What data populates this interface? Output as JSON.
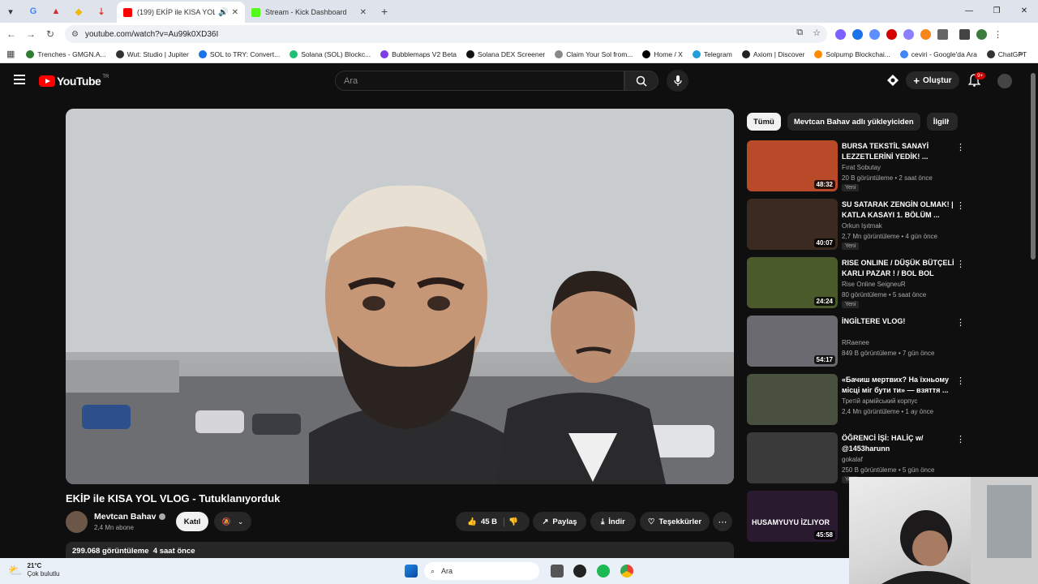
{
  "browser": {
    "tabs": [
      {
        "title": "(199) EKİP ile KISA YOL VLOG",
        "active": true,
        "favicon_color": "#ff0000"
      },
      {
        "title": "Stream - Kick Dashboard",
        "active": false,
        "favicon_color": "#53fc18"
      }
    ],
    "url": "youtube.com/watch?v=Au99k0XD36I",
    "bookmarks": [
      {
        "label": "Trenches - GMGN.A...",
        "color": "#2e7d32"
      },
      {
        "label": "Wut: Studio | Jupiter",
        "color": "#333333"
      },
      {
        "label": "SOL to TRY: Convert...",
        "color": "#1a73e8"
      },
      {
        "label": "Solana (SOL) Blockc...",
        "color": "#21bf73"
      },
      {
        "label": "Bubblemaps V2 Beta",
        "color": "#7b3fe4"
      },
      {
        "label": "Solana DEX Screener",
        "color": "#111111"
      },
      {
        "label": "Claim Your Sol from...",
        "color": "#888888"
      },
      {
        "label": "Home / X",
        "color": "#000000"
      },
      {
        "label": "Telegram",
        "color": "#229ed9"
      },
      {
        "label": "Axiom | Discover",
        "color": "#222222"
      },
      {
        "label": "Solpump Blockchai...",
        "color": "#ff8c00"
      },
      {
        "label": "ceviri - Google'da Ara",
        "color": "#4285f4"
      },
      {
        "label": "ChatGPT",
        "color": "#333333"
      }
    ]
  },
  "youtube": {
    "logo_text": "YouTube",
    "country_code": "TR",
    "search_placeholder": "Ara",
    "create_label": "Oluştur",
    "notification_count": "9+",
    "video": {
      "title": "EKİP ile KISA YOL VLOG - Tutuklanıyorduk",
      "channel": "Mevtcan Bahav",
      "subscribers": "2,4 Mn abone",
      "join_label": "Katıl",
      "likes": "45 B",
      "share_label": "Paylaş",
      "download_label": "İndir",
      "thanks_label": "Teşekkürler",
      "views": "299.068 görüntüleme",
      "age": "4 saat önce"
    },
    "chips": [
      "Tümü",
      "Mevtcan Bahav adlı yükleyiciden",
      "İlgili"
    ],
    "recommendations": [
      {
        "title": "BURSA TEKSTİL SANAYİ LEZZETLERİNİ YEDİK! ...",
        "channel": "Fırat Sobutay",
        "meta": "20 B görüntüleme • 2 saat önce",
        "badge": "Yeni",
        "duration": "48:32",
        "thumb": "#b84a2a"
      },
      {
        "title": "SU SATARAK ZENGİN OLMAK! | KATLA KASAYI 1. BÖLÜM ...",
        "channel": "Orkun Işıtmak",
        "meta": "2,7 Mn görüntüleme • 4 gün önce",
        "badge": "Yeni",
        "duration": "40:07",
        "thumb": "#3a2a20"
      },
      {
        "title": "RISE ONLINE / DÜŞÜK BÜTÇELİ KARLI PAZAR ! / BOL BOL FAR...",
        "channel": "Rise Online SeigneuR",
        "meta": "80 görüntüleme • 5 saat önce",
        "badge": "Yeni",
        "duration": "24:24",
        "thumb": "#4a5a2a"
      },
      {
        "title": "İNGİLTERE VLOG!",
        "channel": "RRaenee",
        "meta": "849 B görüntüleme • 7 gün önce",
        "badge": "",
        "duration": "54:17",
        "thumb": "#6a6a70"
      },
      {
        "title": "«Бачиш мертвих? На їхньому місці міг бути ти» — взяття ...",
        "channel": "Третій армійський корпус",
        "meta": "2,4 Mn görüntüleme • 1 ay önce",
        "badge": "",
        "duration": "",
        "thumb": "#4a5040"
      },
      {
        "title": "ÖĞRENCİ İŞİ: HALİÇ w/ @1453harunn",
        "channel": "gokalaf",
        "meta": "250 B görüntüleme • 5 gün önce",
        "badge": "Yeni",
        "duration": "",
        "thumb": "#3a3a3a"
      },
      {
        "title": "",
        "channel": "",
        "meta": "",
        "badge": "",
        "duration": "45:58",
        "thumb": "#2a1a30",
        "overlay": "HUSAMYUYU İZLIYOR"
      }
    ]
  },
  "taskbar": {
    "temperature": "21°C",
    "weather": "Çok bulutlu",
    "search_label": "Ara"
  }
}
